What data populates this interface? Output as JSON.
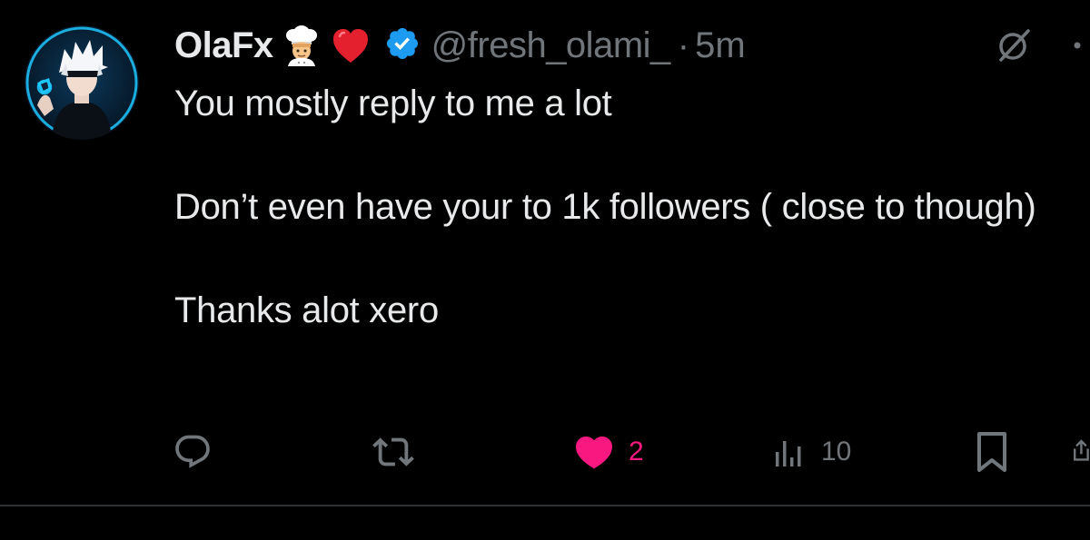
{
  "colors": {
    "background": "#000000",
    "text": "#e7e9ea",
    "secondary_text": "#71767b",
    "verified_blue": "#1d9bf0",
    "like_pink": "#f91880",
    "divider": "#2f3336"
  },
  "tweet": {
    "author": {
      "display_name": "OlaFx",
      "name_emojis": [
        "cook-emoji",
        "red-heart-emoji"
      ],
      "verified": true,
      "handle": "@fresh_olami_",
      "separator": "·",
      "time": "5m"
    },
    "text": {
      "line1": "You mostly reply to me a lot",
      "line2": "Don’t even have your to 1k followers ( close to though)",
      "line3": "Thanks alot xero"
    },
    "actions": {
      "reply": {
        "icon": "reply-icon",
        "count": ""
      },
      "retweet": {
        "icon": "retweet-icon",
        "count": ""
      },
      "like": {
        "icon": "heart-filled-icon",
        "count": "2",
        "liked": true
      },
      "views": {
        "icon": "views-bar-chart-icon",
        "count": "10"
      },
      "bookmark": {
        "icon": "bookmark-icon"
      },
      "share": {
        "icon": "share-icon"
      }
    },
    "header_icons": [
      "grok-icon",
      "more-icon"
    ]
  }
}
